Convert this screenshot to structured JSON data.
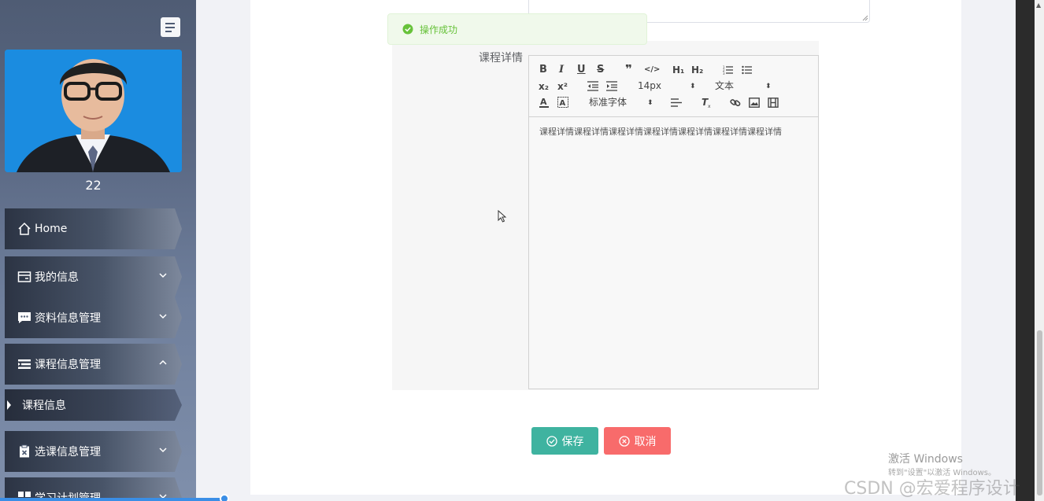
{
  "sidebar": {
    "user_name": "22",
    "menu": [
      {
        "label": "Home",
        "icon": "home-icon"
      },
      {
        "label": "我的信息",
        "icon": "id-card-icon"
      },
      {
        "label": "资料信息管理",
        "icon": "chat-icon"
      },
      {
        "label": "课程信息管理",
        "icon": "list-icon"
      },
      {
        "label": "选课信息管理",
        "icon": "clipboard-icon"
      },
      {
        "label": "学习计划管理",
        "icon": "grid-icon"
      }
    ],
    "submenu": [
      {
        "label": "课程信息"
      }
    ]
  },
  "toast": {
    "message": "操作成功",
    "color": "#67c23a"
  },
  "form": {
    "detail_label": "课程详情",
    "editor_content": "课程详情课程详情课程详情课程详情课程详情课程详情课程详情",
    "toolbar": {
      "font_size": "14px",
      "paragraph": "文本",
      "font_family": "标准字体"
    },
    "save_label": "保存",
    "cancel_label": "取消",
    "save_color": "#3fb3a0",
    "cancel_color": "#f86b6b"
  },
  "watermark": {
    "line1": "激活 Windows",
    "line2": "转到\"设置\"以激活 Windows。",
    "line3": "CSDN @宏爱程序设计"
  }
}
